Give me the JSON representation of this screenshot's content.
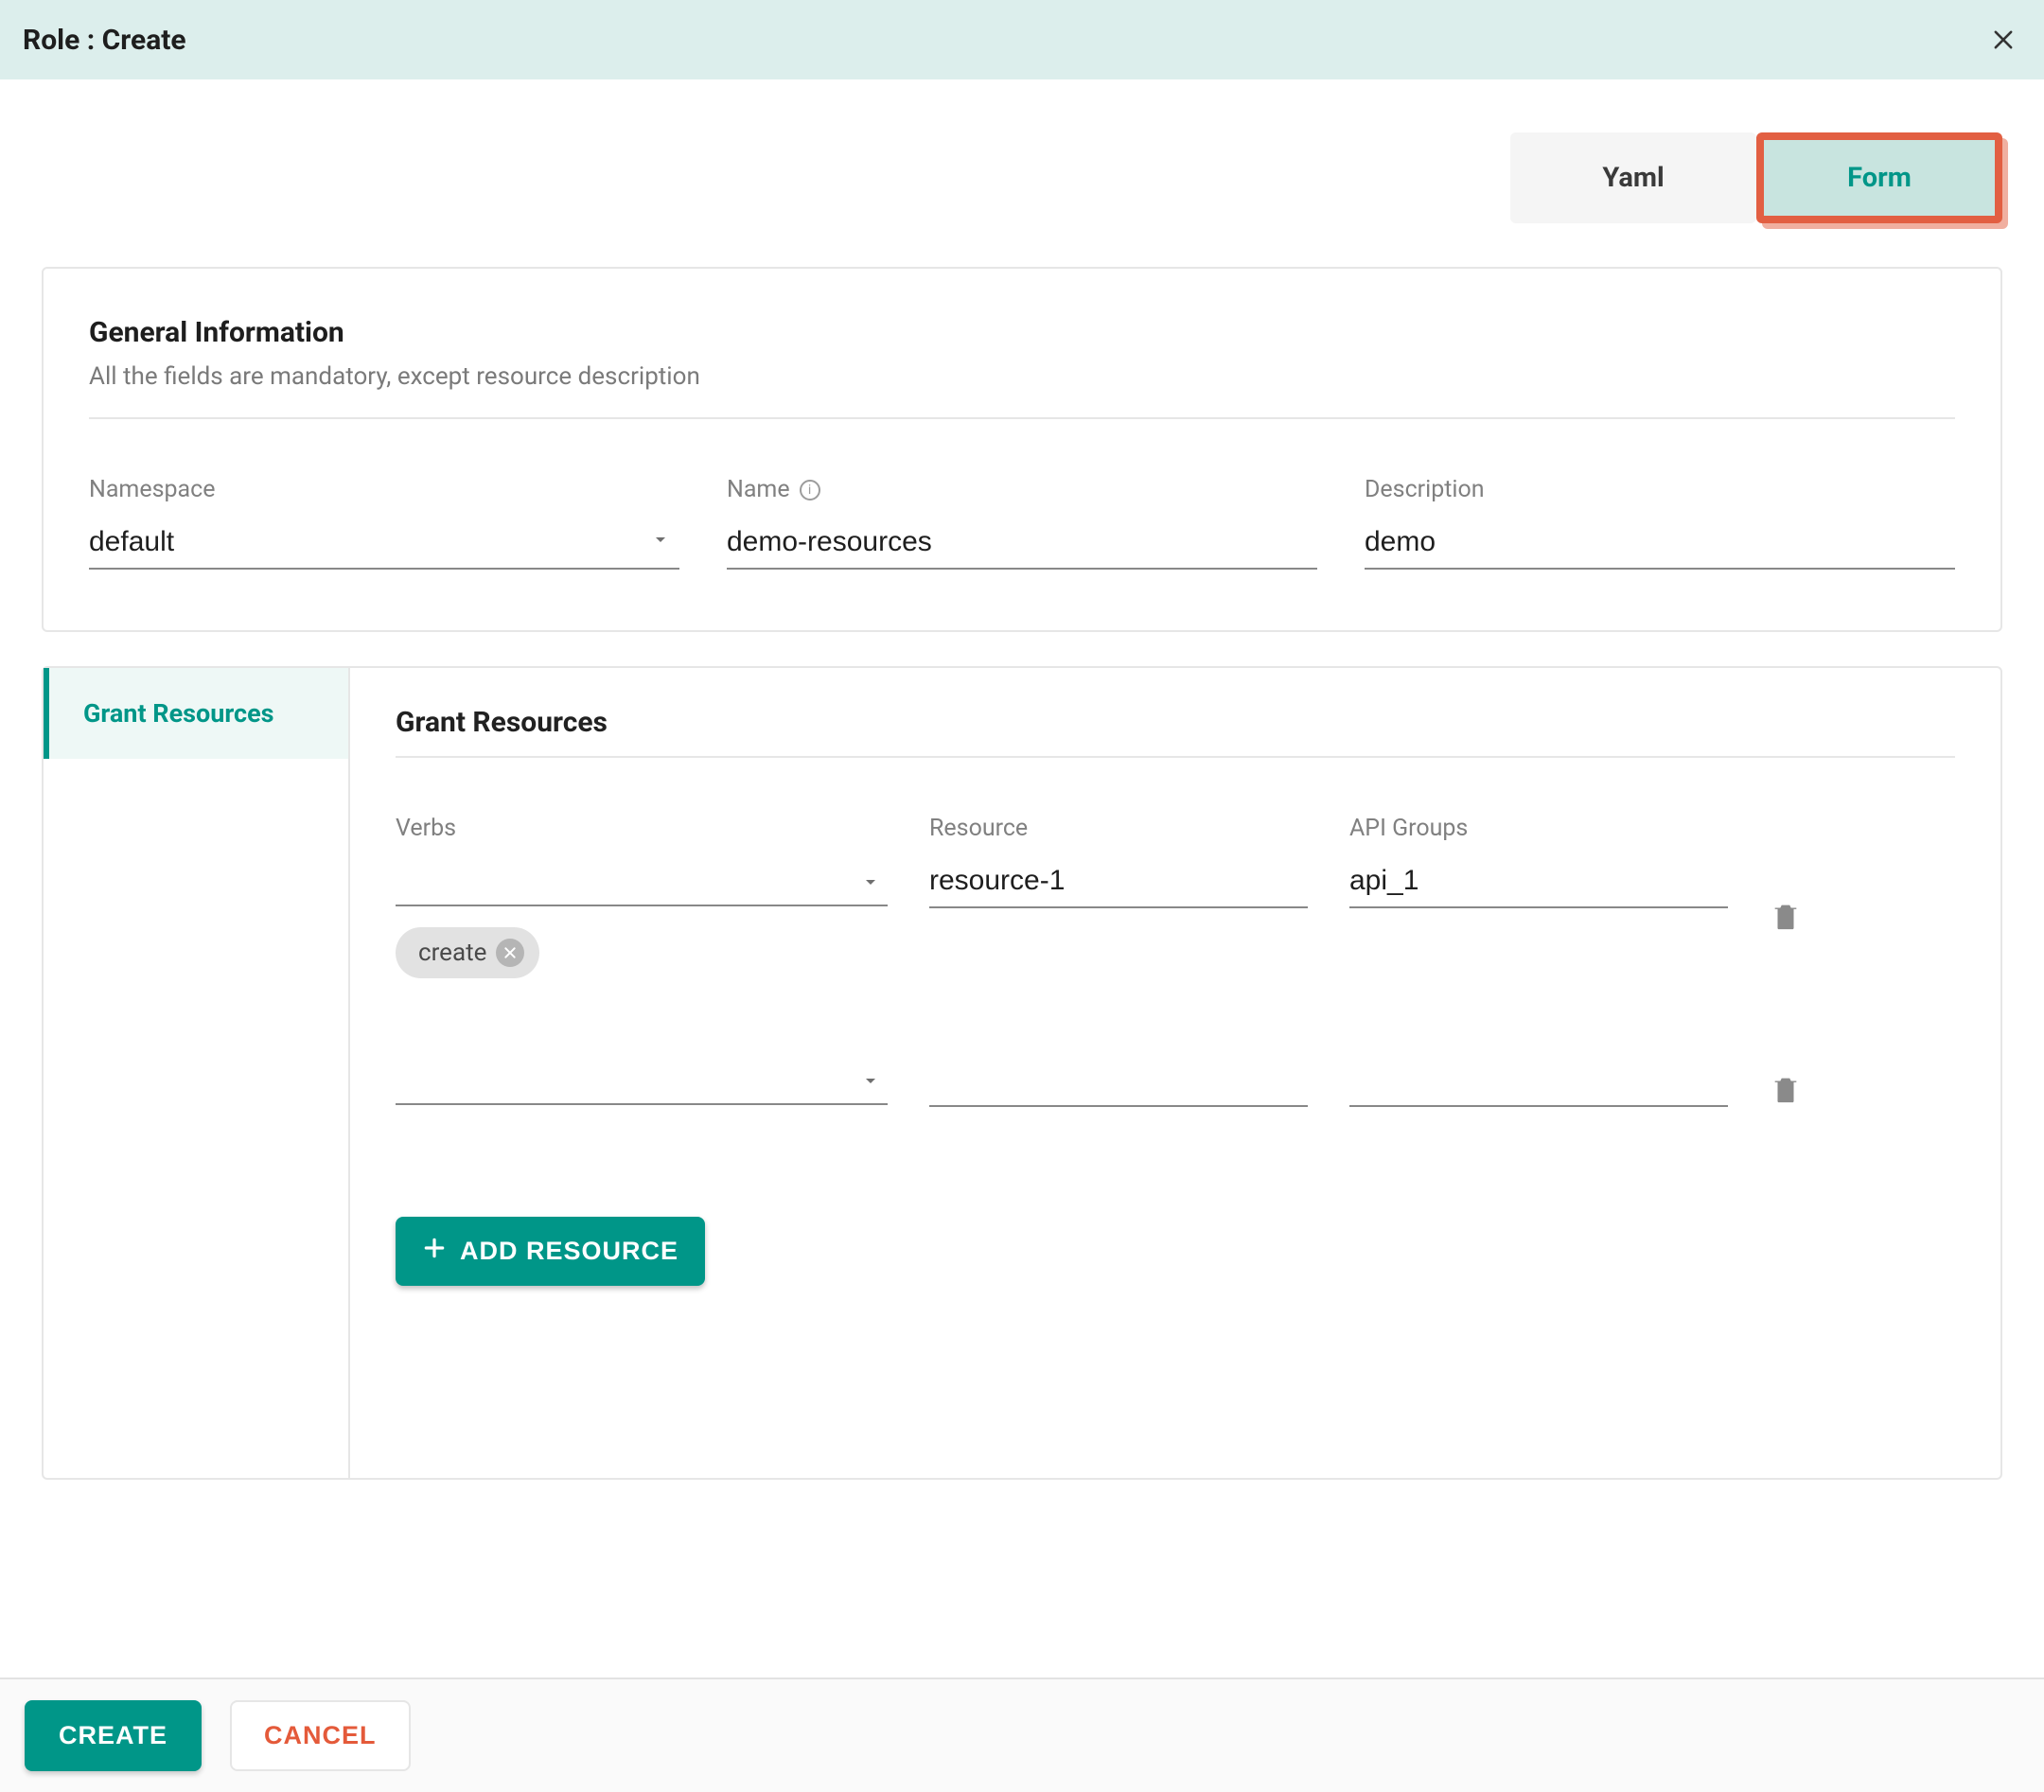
{
  "header": {
    "title": "Role : Create"
  },
  "tabs": {
    "yaml": "Yaml",
    "form": "Form"
  },
  "general": {
    "title": "General Information",
    "subtitle": "All the fields are mandatory, except resource description",
    "namespace_label": "Namespace",
    "namespace_value": "default",
    "name_label": "Name",
    "name_value": "demo-resources",
    "description_label": "Description",
    "description_value": "demo"
  },
  "sidebar": {
    "grant_resources": "Grant Resources"
  },
  "grant": {
    "title": "Grant Resources",
    "verbs_label": "Verbs",
    "resource_label": "Resource",
    "api_groups_label": "API Groups",
    "rows": [
      {
        "verbs_chip": "create",
        "resource": "resource-1",
        "api_groups": "api_1"
      },
      {
        "verbs_chip": "",
        "resource": "",
        "api_groups": ""
      }
    ],
    "add_resource": "ADD RESOURCE"
  },
  "footer": {
    "create": "CREATE",
    "cancel": "CANCEL"
  }
}
